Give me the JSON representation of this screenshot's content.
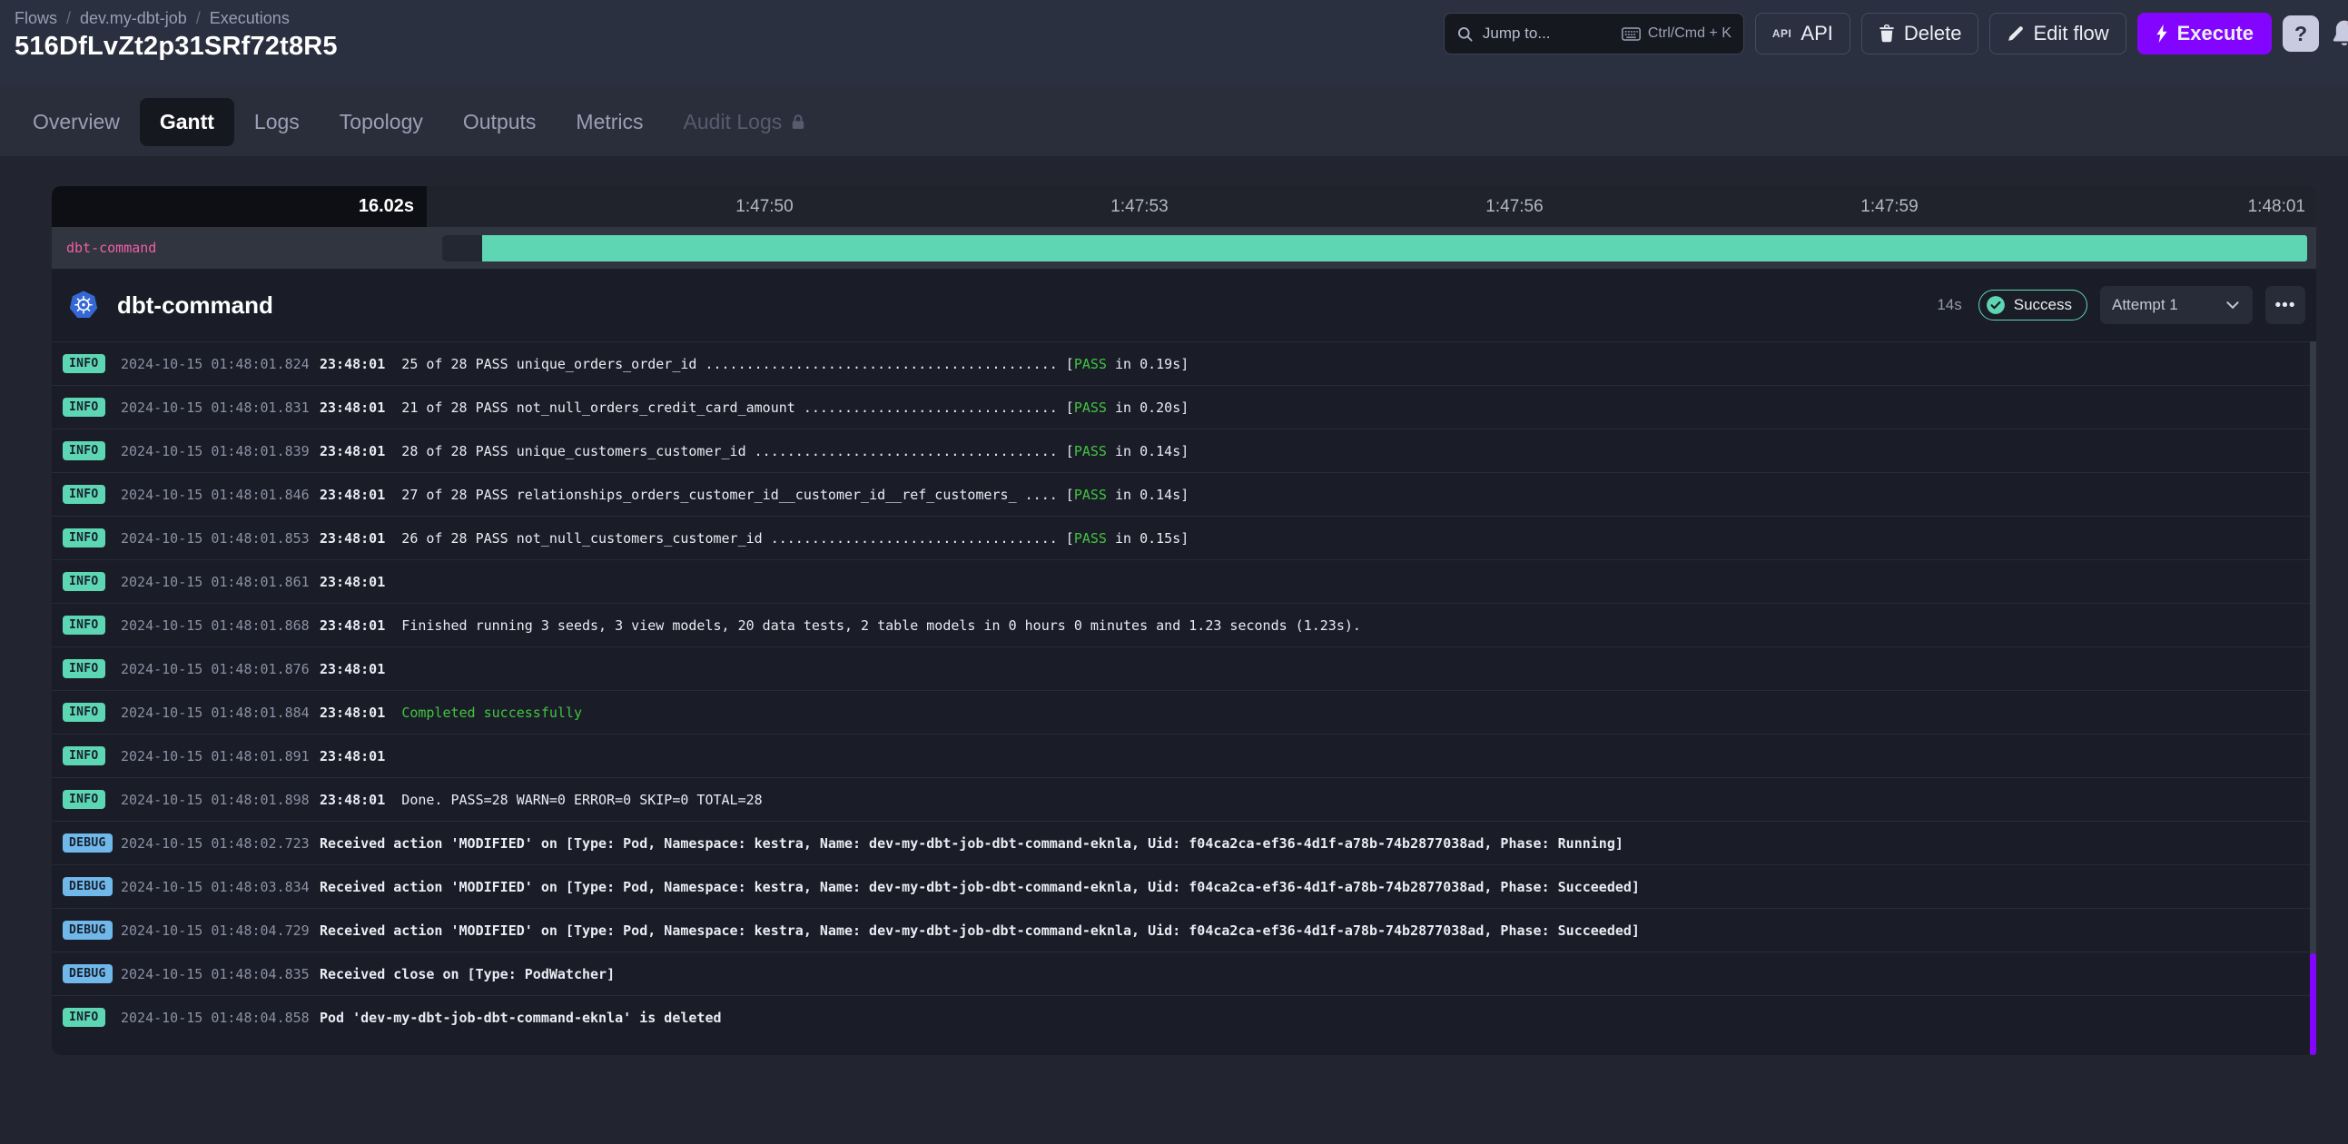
{
  "header": {
    "breadcrumb": [
      "Flows",
      "dev.my-dbt-job",
      "Executions"
    ],
    "title": "516DfLvZt2p31SRf72t8R5",
    "search": {
      "placeholder": "Jump to...",
      "shortcut": "Ctrl/Cmd + K"
    },
    "buttons": {
      "api": "API",
      "delete": "Delete",
      "edit_flow": "Edit flow",
      "execute": "Execute",
      "help": "?"
    }
  },
  "tabs": [
    {
      "label": "Overview"
    },
    {
      "label": "Gantt",
      "active": true
    },
    {
      "label": "Logs"
    },
    {
      "label": "Topology"
    },
    {
      "label": "Outputs"
    },
    {
      "label": "Metrics"
    },
    {
      "label": "Audit Logs",
      "locked": true
    }
  ],
  "gantt": {
    "duration_label": "16.02s",
    "ticks": [
      "1:47:50",
      "1:47:53",
      "1:47:56",
      "1:47:59",
      "1:48:01"
    ],
    "row_label": "dbt-command"
  },
  "task": {
    "name": "dbt-command",
    "duration": "14s",
    "status": "Success",
    "attempt": "Attempt 1",
    "more": "•••"
  },
  "logs": [
    {
      "level": "INFO",
      "ts": "2024-10-15 01:48:01.824",
      "parts": [
        {
          "t": "23:48:01",
          "b": 1
        },
        {
          "t": "  25 of 28 PASS unique_orders_order_id ........................................... ["
        },
        {
          "t": "PASS",
          "g": 1
        },
        {
          "t": " in 0.19s]"
        }
      ]
    },
    {
      "level": "INFO",
      "ts": "2024-10-15 01:48:01.831",
      "parts": [
        {
          "t": "23:48:01",
          "b": 1
        },
        {
          "t": "  21 of 28 PASS not_null_orders_credit_card_amount ............................... ["
        },
        {
          "t": "PASS",
          "g": 1
        },
        {
          "t": " in 0.20s]"
        }
      ]
    },
    {
      "level": "INFO",
      "ts": "2024-10-15 01:48:01.839",
      "parts": [
        {
          "t": "23:48:01",
          "b": 1
        },
        {
          "t": "  28 of 28 PASS unique_customers_customer_id ..................................... ["
        },
        {
          "t": "PASS",
          "g": 1
        },
        {
          "t": " in 0.14s]"
        }
      ]
    },
    {
      "level": "INFO",
      "ts": "2024-10-15 01:48:01.846",
      "parts": [
        {
          "t": "23:48:01",
          "b": 1
        },
        {
          "t": "  27 of 28 PASS relationships_orders_customer_id__customer_id__ref_customers_ .... ["
        },
        {
          "t": "PASS",
          "g": 1
        },
        {
          "t": " in 0.14s]"
        }
      ]
    },
    {
      "level": "INFO",
      "ts": "2024-10-15 01:48:01.853",
      "parts": [
        {
          "t": "23:48:01",
          "b": 1
        },
        {
          "t": "  26 of 28 PASS not_null_customers_customer_id ................................... ["
        },
        {
          "t": "PASS",
          "g": 1
        },
        {
          "t": " in 0.15s]"
        }
      ]
    },
    {
      "level": "INFO",
      "ts": "2024-10-15 01:48:01.861",
      "parts": [
        {
          "t": "23:48:01",
          "b": 1
        }
      ]
    },
    {
      "level": "INFO",
      "ts": "2024-10-15 01:48:01.868",
      "parts": [
        {
          "t": "23:48:01",
          "b": 1
        },
        {
          "t": "  Finished running 3 seeds, 3 view models, 20 data tests, 2 table models in 0 hours 0 minutes and 1.23 seconds (1.23s)."
        }
      ]
    },
    {
      "level": "INFO",
      "ts": "2024-10-15 01:48:01.876",
      "parts": [
        {
          "t": "23:48:01",
          "b": 1
        }
      ]
    },
    {
      "level": "INFO",
      "ts": "2024-10-15 01:48:01.884",
      "parts": [
        {
          "t": "23:48:01",
          "b": 1
        },
        {
          "t": "  "
        },
        {
          "t": "Completed successfully",
          "g": 1
        }
      ]
    },
    {
      "level": "INFO",
      "ts": "2024-10-15 01:48:01.891",
      "parts": [
        {
          "t": "23:48:01",
          "b": 1
        }
      ]
    },
    {
      "level": "INFO",
      "ts": "2024-10-15 01:48:01.898",
      "parts": [
        {
          "t": "23:48:01",
          "b": 1
        },
        {
          "t": "  Done. PASS=28 WARN=0 ERROR=0 SKIP=0 TOTAL=28"
        }
      ]
    },
    {
      "level": "DEBUG",
      "ts": "2024-10-15 01:48:02.723",
      "parts": [
        {
          "t": "Received action 'MODIFIED' on [Type: Pod, Namespace: kestra, Name: dev-my-dbt-job-dbt-command-eknla, Uid: f04ca2ca-ef36-4d1f-a78b-74b2877038ad, Phase: Running]",
          "b": 1
        }
      ]
    },
    {
      "level": "DEBUG",
      "ts": "2024-10-15 01:48:03.834",
      "parts": [
        {
          "t": "Received action 'MODIFIED' on [Type: Pod, Namespace: kestra, Name: dev-my-dbt-job-dbt-command-eknla, Uid: f04ca2ca-ef36-4d1f-a78b-74b2877038ad, Phase: Succeeded]",
          "b": 1
        }
      ]
    },
    {
      "level": "DEBUG",
      "ts": "2024-10-15 01:48:04.729",
      "parts": [
        {
          "t": "Received action 'MODIFIED' on [Type: Pod, Namespace: kestra, Name: dev-my-dbt-job-dbt-command-eknla, Uid: f04ca2ca-ef36-4d1f-a78b-74b2877038ad, Phase: Succeeded]",
          "b": 1
        }
      ]
    },
    {
      "level": "DEBUG",
      "ts": "2024-10-15 01:48:04.835",
      "parts": [
        {
          "t": "Received close on [Type: PodWatcher]",
          "b": 1
        }
      ]
    },
    {
      "level": "INFO",
      "ts": "2024-10-15 01:48:04.858",
      "parts": [
        {
          "t": "Pod 'dev-my-dbt-job-dbt-command-eknla' is deleted",
          "b": 1
        }
      ]
    }
  ],
  "colors": {
    "success_teal": "#5ed6b4",
    "debug_blue": "#70b7ea",
    "log_green": "#41c440",
    "task_label_pink": "#f060a6",
    "brand_purple": "#8405ff"
  }
}
